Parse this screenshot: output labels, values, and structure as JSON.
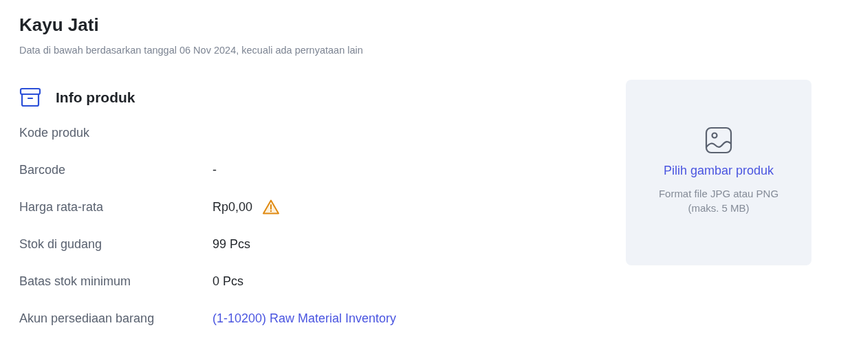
{
  "title": "Kayu Jati",
  "subtitle": "Data di bawah berdasarkan tanggal 06 Nov 2024, kecuali ada pernyataan lain",
  "section": {
    "title": "Info produk"
  },
  "rows": [
    {
      "label": "Kode produk"
    },
    {
      "label": "Barcode",
      "value": "-",
      "kind": "text"
    },
    {
      "label": "Harga rata-rata",
      "value": "Rp0,00",
      "kind": "text",
      "warning": true
    },
    {
      "label": "Stok di gudang",
      "value": "99 Pcs",
      "kind": "text"
    },
    {
      "label": "Batas stok minimum",
      "value": "0 Pcs",
      "kind": "text"
    },
    {
      "label": "Akun persediaan barang",
      "value": "(1-10200) Raw Material Inventory",
      "kind": "link"
    }
  ],
  "image_upload": {
    "action": "Pilih gambar produk",
    "hint": "Format file JPG atau PNG (maks. 5 MB)"
  }
}
